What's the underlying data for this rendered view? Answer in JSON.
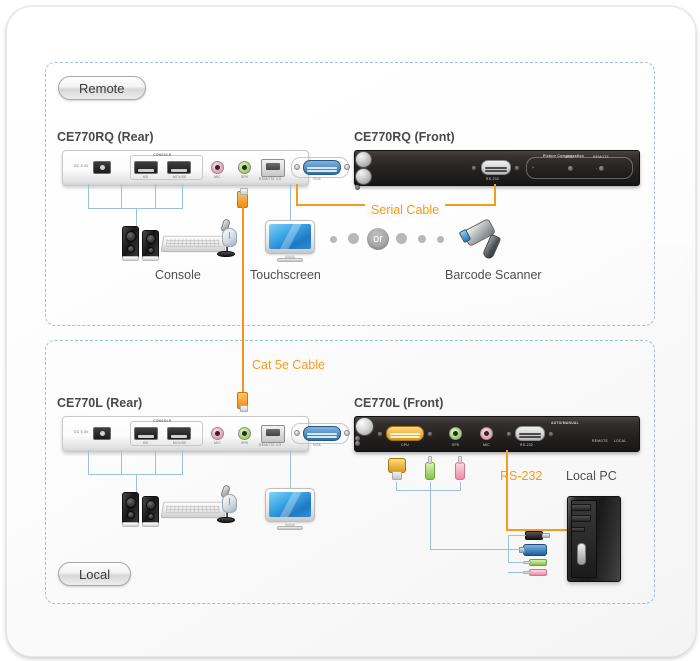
{
  "diagram": {
    "zones": {
      "remote_label": "Remote",
      "local_label": "Local"
    },
    "devices": [
      {
        "id": "ce770rq_rear",
        "title": "CE770RQ (Rear)"
      },
      {
        "id": "ce770rq_front",
        "title": "CE770RQ (Front)"
      },
      {
        "id": "ce770l_rear",
        "title": "CE770L (Rear)"
      },
      {
        "id": "ce770l_front",
        "title": "CE770L (Front)"
      }
    ],
    "rear_panel_silkscreen": {
      "power": "DC 5.3V",
      "console": "CONSOLE",
      "usb_keyboard": "KB",
      "usb_mouse": "MOUSE",
      "mic": "MIC",
      "speaker": "SPK",
      "rj45": "REMOTE I/O",
      "vga": "VGA"
    },
    "rq_front_silkscreen": {
      "serial": "RS-232",
      "compensation": "Picture Compensation",
      "minus": "-",
      "plus": "+",
      "link_led": "LINK",
      "remote_led": "REMOTE"
    },
    "l_front_silkscreen": {
      "cpu": "CPU",
      "speaker": "SPK",
      "mic": "MIC",
      "serial": "RS-232",
      "auto_manual": "AUTO/MANUAL",
      "remote_led": "REMOTE",
      "local_led": "LOCAL"
    },
    "captions": {
      "console": "Console",
      "touchscreen": "Touchscreen",
      "or": "or",
      "barcode_scanner": "Barcode Scanner",
      "serial_cable": "Serial Cable",
      "cat5e_cable": "Cat 5e Cable",
      "rs232": "RS-232",
      "local_pc": "Local PC"
    },
    "colors": {
      "cable_orange": "#f79421",
      "leader_blue": "#9dc0e0",
      "zone_border": "#9dc0e0",
      "caption_gray": "#4f4f4f",
      "title_gray": "#4a4a4a",
      "mic_pink": "#e888a6",
      "speaker_green": "#83c341",
      "vga_blue": "#2f6fa8",
      "vga_gold": "#d79a19"
    }
  }
}
